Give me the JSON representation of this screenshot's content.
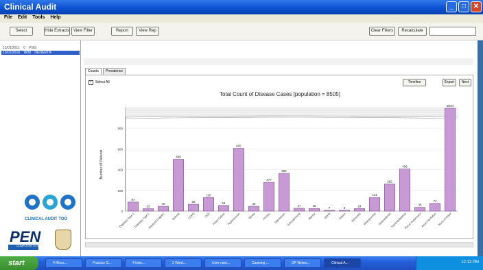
{
  "window": {
    "title": "Clinical Audit"
  },
  "menu": [
    "File",
    "Edit",
    "Tools",
    "Help"
  ],
  "toolbar": {
    "select": "Select",
    "hide_extracts": "Hide Extracts",
    "view_filter": "View Filter",
    "report": "Report",
    "view_rep": "View Rep",
    "clear_filters": "Clear Filters",
    "recalculate": "Recalculate"
  },
  "left_list": {
    "row1": "12/01/2011    0    PSG",
    "row2": "13/01/2016    WIM    DEDENTIF"
  },
  "logo": {
    "text": "CLINICAL AUDIT TOO",
    "pen": "PEN",
    "pen_sub": "COMPUTER SYSTEMS"
  },
  "tabs": [
    "Counts",
    "Prevalence"
  ],
  "select_all": "Select All",
  "panel_buttons": {
    "timeline": "Timeline",
    "export": "Export",
    "next": "Next"
  },
  "chart_data": {
    "type": "bar",
    "title": "Total Count of Disease Cases [population = 8505]",
    "ylabel": "Number of Patients",
    "xlabel": "",
    "ylim": [
      0,
      900
    ],
    "broken_axis": true,
    "categories": [
      "Diabetes Type 1",
      "Diabetes Type 1",
      "Impaired Diabetic",
      "Asthma",
      "COPD",
      "CKD",
      "Heart Failure",
      "Hypertension",
      "Stroke",
      "Anxiety",
      "Depression",
      "Schizophrenia",
      "Bipolar",
      "ADHD",
      "Autism",
      "Dementia",
      "Osteoporosis",
      "Osteoarthritis",
      "Hyperlipidaemia",
      "Renal Impairment",
      "Atrial Fibrillation",
      "None of these"
    ],
    "values": [
      87,
      23,
      46,
      499,
      66,
      130,
      54,
      605,
      46,
      277,
      364,
      27,
      25,
      7,
      8,
      24,
      131,
      262,
      406,
      35,
      74,
      8944
    ],
    "yticks": [
      "0",
      "200",
      "400",
      "600",
      "800"
    ],
    "bar_color": "#c79ad6"
  },
  "taskbar": {
    "start": "start",
    "tasks": [
      "4 Micro...",
      "Practice S...",
      "4 Inter...",
      "2 Wind...",
      "User nam...",
      "Canising ...",
      "GP Netwo...",
      "Clinical A..."
    ],
    "clock": "12:13 PM"
  }
}
